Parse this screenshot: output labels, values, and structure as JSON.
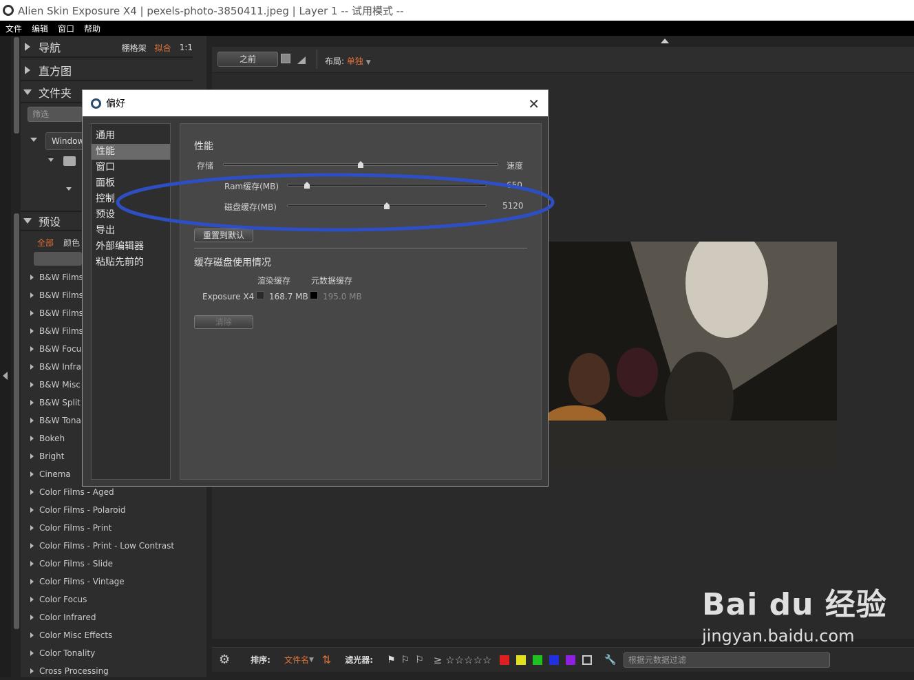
{
  "window": {
    "title": "Alien Skin Exposure X4 | pexels-photo-3850411.jpeg | Layer 1 -- 试用模式 --"
  },
  "menu": [
    "文件",
    "编辑",
    "窗口",
    "帮助"
  ],
  "left_panel": {
    "navigator": {
      "label": "导航",
      "options": [
        "棚格架",
        "拟合",
        "1:1"
      ]
    },
    "histogram": {
      "label": "直方图"
    },
    "folders": {
      "label": "文件夹",
      "filter_placeholder": "筛选",
      "drive": "Windows"
    },
    "presets": {
      "label": "预设",
      "tabs": [
        "全部",
        "颜色"
      ],
      "items": [
        "B&W Films",
        "B&W Films",
        "B&W Films",
        "B&W Films",
        "B&W Focus",
        "B&W Infrar",
        "B&W Misc",
        "B&W Split T",
        "B&W Tonal",
        "Bokeh",
        "Bright",
        "Cinema",
        "Color Films - Aged",
        "Color Films - Polaroid",
        "Color Films - Print",
        "Color Films - Print - Low Contrast",
        "Color Films - Slide",
        "Color Films - Vintage",
        "Color Focus",
        "Color Infrared",
        "Color Misc Effects",
        "Color Tonality",
        "Cross Processing"
      ]
    }
  },
  "toolbar": {
    "before_label": "之前",
    "layout_label": "布局:",
    "layout_value": "单独"
  },
  "bottom": {
    "sort_label": "排序:",
    "sort_value": "文件名",
    "filter_label": "滤光器:",
    "search_placeholder": "根据元数据过滤"
  },
  "dialog": {
    "title": "偏好",
    "nav": [
      "通用",
      "性能",
      "窗口",
      "面板",
      "控制",
      "预设",
      "导出",
      "外部编辑器",
      "粘贴先前的"
    ],
    "selected_nav": "性能",
    "performance": {
      "heading": "性能",
      "left_label": "存储",
      "right_label": "速度",
      "balance_value": 0.5,
      "ram_label": "Ram缓存(MB)",
      "ram_value": "650",
      "ram_fraction": 0.1,
      "disk_label": "磁盘缓存(MB)",
      "disk_value": "5120",
      "disk_fraction": 0.5,
      "reset_label": "重置到默认"
    },
    "cache": {
      "heading": "缓存磁盘使用情况",
      "col_render": "渲染缓存",
      "col_meta": "元数据缓存",
      "row_label": "Exposure X4",
      "render_value": "168.7 MB",
      "meta_value": "195.0 MB",
      "clear_label": "清除"
    }
  },
  "watermark": {
    "text": "Bai du 经验",
    "url": "jingyan.baidu.com"
  },
  "colors": {
    "accent": "#e0733a",
    "annotation": "#2e4fc4"
  }
}
